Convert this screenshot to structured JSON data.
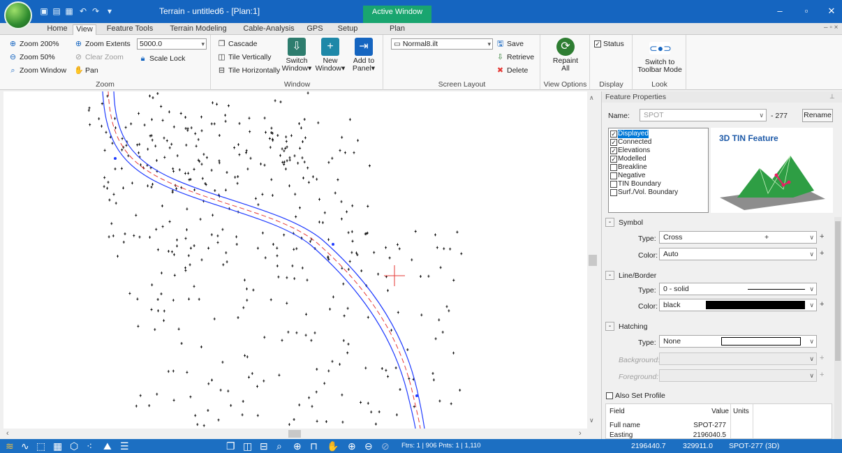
{
  "titlebar": {
    "title": "Terrain - untitled6 - [Plan:1]",
    "active_label": "Active Window",
    "window_buttons": [
      "–",
      "▫",
      "✕"
    ]
  },
  "tabs": [
    "Home",
    "View",
    "Feature Tools",
    "Terrain Modeling",
    "Cable-Analysis",
    "GPS",
    "Setup",
    "Plan"
  ],
  "ribbon": {
    "zoom": {
      "label": "Zoom",
      "zoom200": "Zoom 200%",
      "zoom50": "Zoom 50%",
      "zoom_window": "Zoom Window",
      "zoom_extents": "Zoom Extents",
      "clear_zoom": "Clear Zoom",
      "pan": "Pan",
      "scale_value": "5000.0",
      "scale_lock": "Scale Lock"
    },
    "window": {
      "label": "Window",
      "cascade": "Cascade",
      "tile_vertically": "Tile Vertically",
      "tile_horizontally": "Tile Horizontally",
      "switch_window_1": "Switch",
      "switch_window_2": "Window",
      "new_window_1": "New",
      "new_window_2": "Window",
      "add_panel_1": "Add to",
      "add_panel_2": "Panel"
    },
    "screen_layout": {
      "label": "Screen Layout",
      "layout_file": "Normal8.ilt",
      "save": "Save",
      "retrieve": "Retrieve",
      "delete": "Delete"
    },
    "view_options": {
      "label": "View Options",
      "repaint_1": "Repaint",
      "repaint_2": "All"
    },
    "display": {
      "label": "Display",
      "status": "Status"
    },
    "look": {
      "label": "Look",
      "switch_1": "Switch to",
      "switch_2": "Toolbar Mode"
    }
  },
  "panel": {
    "title": "Feature Properties",
    "name_label": "Name:",
    "name_value": "SPOT",
    "name_number": "- 277",
    "rename": "Rename",
    "flags": [
      {
        "label": "Displayed",
        "checked": true
      },
      {
        "label": "Connected",
        "checked": true
      },
      {
        "label": "Elevations",
        "checked": true
      },
      {
        "label": "Modelled",
        "checked": true
      },
      {
        "label": "Breakline",
        "checked": false
      },
      {
        "label": "Negative",
        "checked": false
      },
      {
        "label": "TIN Boundary",
        "checked": false
      },
      {
        "label": "Surf./Vol. Boundary",
        "checked": false
      }
    ],
    "tin_title": "3D TIN Feature",
    "symbol": {
      "header": "Symbol",
      "type_label": "Type:",
      "type_value": "Cross",
      "color_label": "Color:",
      "color_value": "Auto"
    },
    "line": {
      "header": "Line/Border",
      "type_label": "Type:",
      "type_value": "0 - solid",
      "color_label": "Color:",
      "color_value": "black"
    },
    "hatching": {
      "header": "Hatching",
      "type_label": "Type:",
      "type_value": "None",
      "bg_label": "Background:",
      "fg_label": "Foreground:"
    },
    "also_set_profile": "Also Set Profile",
    "table": {
      "headers": [
        "Field",
        "Value",
        "Units"
      ],
      "rows": [
        [
          "Full name",
          "SPOT-277",
          ""
        ],
        [
          "Easting",
          "2196040.5",
          ""
        ]
      ]
    }
  },
  "status": {
    "counts": "Ftrs: 1 | 906  Pnts: 1 | 1,110",
    "x": "2196440.7",
    "y": "329911.0",
    "feature": "SPOT-277 (3D)"
  },
  "colors": {
    "title_bg": "#1565c0",
    "status_bg": "#1c6fc2",
    "active_window": "#19a56f",
    "road_blue": "#1f3bff",
    "road_center": "#e53935"
  }
}
